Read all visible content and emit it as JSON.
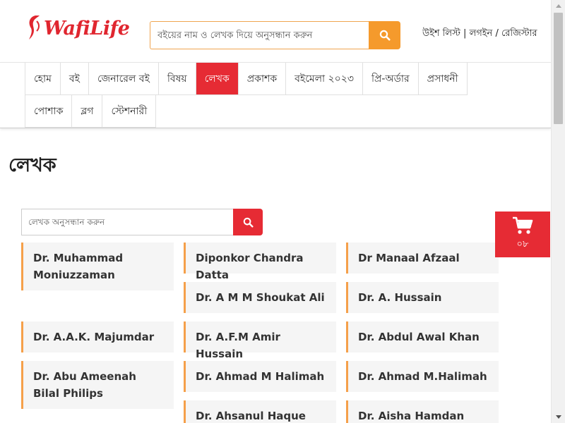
{
  "header": {
    "logo_text": "WafiLife",
    "search_placeholder": "বইয়ের নাম ও লেখক দিয়ে অনুসন্ধান করুন",
    "account_links": [
      "উইশ লিস্ট",
      "লগইন",
      "রেজিস্টার"
    ],
    "separators": [
      " | ",
      " / "
    ]
  },
  "nav": {
    "items": [
      {
        "label": "হোম",
        "active": false
      },
      {
        "label": "বই",
        "active": false
      },
      {
        "label": "জেনারেল বই",
        "active": false
      },
      {
        "label": "বিষয়",
        "active": false
      },
      {
        "label": "লেখক",
        "active": true
      },
      {
        "label": "প্রকাশক",
        "active": false
      },
      {
        "label": "বইমেলা ২০২৩",
        "active": false
      },
      {
        "label": "প্রি-অর্ডার",
        "active": false
      },
      {
        "label": "প্রসাধনী",
        "active": false
      },
      {
        "label": "পোশাক",
        "active": false
      },
      {
        "label": "ব্লগ",
        "active": false
      },
      {
        "label": "স্টেশনারী",
        "active": false
      }
    ]
  },
  "page": {
    "title": "লেখক",
    "search_placeholder": "লেখক অনুসন্ধান করুন"
  },
  "authors": [
    " Dr. Muhammad Moniuzzaman",
    "Diponkor Chandra Datta",
    "Dr Manaal Afzaal",
    "Dr. A M M Shoukat Ali",
    "Dr. A. Hussain",
    "Dr. A.A.K. Majumdar",
    "Dr. A.F.M Amir Hussain",
    "Dr. Abdul Awal Khan",
    "Dr. Abu Ameenah Bilal Philips",
    "Dr. Ahmad M Halimah",
    "Dr. Ahmad M.Halimah",
    "Dr. Ahsanul Haque",
    "Dr. Aisha Hamdan"
  ],
  "cart": {
    "count": "০৮"
  },
  "colors": {
    "brand_red": "#e62b34",
    "search_orange": "#f59a2c",
    "card_border": "#f5a04a",
    "card_bg": "#f5f5f5"
  }
}
